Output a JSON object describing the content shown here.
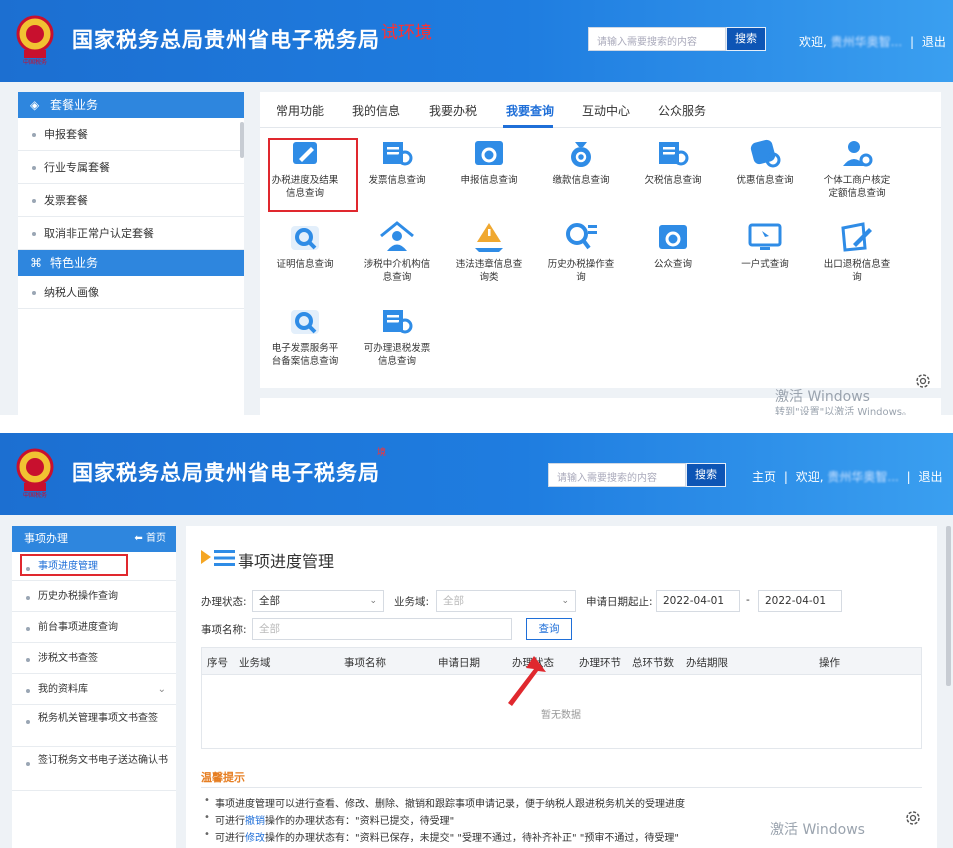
{
  "shot1": {
    "header": {
      "title": "国家税务总局贵州省电子税务局",
      "env_tag": "试环境",
      "search_placeholder": "请输入需要搜索的内容",
      "search_button": "搜索",
      "welcome": "欢迎,",
      "username": "贵州华奥智...",
      "sep": "|",
      "logout": "退出"
    },
    "sidebar": {
      "section1": "套餐业务",
      "items1": [
        "申报套餐",
        "行业专属套餐",
        "发票套餐",
        "取消非正常户认定套餐"
      ],
      "section2": "特色业务",
      "items2": [
        "纳税人画像"
      ]
    },
    "tabs": [
      "常用功能",
      "我的信息",
      "我要办税",
      "我要查询",
      "互动中心",
      "公众服务"
    ],
    "active_tab": "我要查询",
    "tiles": [
      {
        "l1": "办税进度及结果",
        "l2": "信息查询",
        "icon": "pencil-doc-icon",
        "color": "#2f8ce6"
      },
      {
        "l1": "发票信息查询",
        "l2": "",
        "icon": "invoice-search-icon",
        "color": "#2f8ce6"
      },
      {
        "l1": "申报信息查询",
        "l2": "",
        "icon": "window-search-icon",
        "color": "#2f8ce6"
      },
      {
        "l1": "缴款信息查询",
        "l2": "",
        "icon": "money-bag-icon",
        "color": "#2f8ce6"
      },
      {
        "l1": "欠税信息查询",
        "l2": "",
        "icon": "invoice-search-icon",
        "color": "#2f8ce6"
      },
      {
        "l1": "优惠信息查询",
        "l2": "",
        "icon": "discount-tag-icon",
        "color": "#2f8ce6"
      },
      {
        "l1": "个体工商户核定",
        "l2": "定额信息查询",
        "icon": "person-search-icon",
        "color": "#2f8ce6"
      },
      {
        "l1": "证明信息查询",
        "l2": "",
        "icon": "magnifier-icon",
        "color": "#2f8ce6"
      },
      {
        "l1": "涉税中介机构信",
        "l2": "息查询",
        "icon": "agent-house-icon",
        "color": "#2f8ce6"
      },
      {
        "l1": "违法违章信息查",
        "l2": "询类",
        "icon": "warning-hand-icon",
        "color": "#f0a830"
      },
      {
        "l1": "历史办税操作查",
        "l2": "询",
        "icon": "list-search-icon",
        "color": "#2f8ce6"
      },
      {
        "l1": "公众查询",
        "l2": "",
        "icon": "window-search-icon",
        "color": "#2f8ce6"
      },
      {
        "l1": "一户式查询",
        "l2": "",
        "icon": "monitor-cursor-icon",
        "color": "#2f8ce6"
      },
      {
        "l1": "出口退税信息查",
        "l2": "询",
        "icon": "pen-edit-icon",
        "color": "#2f8ce6"
      },
      {
        "l1": "电子发票服务平",
        "l2": "台备案信息查询",
        "icon": "magnifier-icon",
        "color": "#2f8ce6"
      },
      {
        "l1": "可办理退税发票",
        "l2": "信息查询",
        "icon": "invoice-search-icon",
        "color": "#2f8ce6"
      }
    ],
    "watermark": {
      "l1": "激活 Windows",
      "l2": "转到\"设置\"以激活 Windows。"
    }
  },
  "shot2": {
    "header": {
      "title": "国家税务总局贵州省电子税务局",
      "env_tag": "境",
      "search_placeholder": "请输入需要搜索的内容",
      "search_button": "搜索",
      "home": "主页",
      "welcome": "欢迎,",
      "username": "贵州华奥智...",
      "sep": "|",
      "logout": "退出"
    },
    "sidebar": {
      "title": "事项办理",
      "home_link": "首页",
      "items": [
        "事项进度管理",
        "历史办税操作查询",
        "前台事项进度查询",
        "涉税文书查签",
        "我的资料库",
        "税务机关管理事项文书查签",
        "签订税务文书电子送达确认书"
      ]
    },
    "page_title": "事项进度管理",
    "filters": {
      "status_label": "办理状态:",
      "status_value": "全部",
      "domain_label": "业务域:",
      "domain_value": "全部",
      "date_label": "申请日期起止:",
      "date_from": "2022-04-01",
      "date_sep": "-",
      "date_to": "2022-04-01",
      "name_label": "事项名称:",
      "name_value": "全部",
      "query_button": "查询"
    },
    "table": {
      "columns": [
        "序号",
        "业务域",
        "事项名称",
        "申请日期",
        "办理状态",
        "办理环节",
        "总环节数",
        "办结期限",
        "操作"
      ],
      "empty": "暂无数据"
    },
    "tips": {
      "title": "温馨提示",
      "t1": "事项进度管理可以进行查看、修改、删除、撤销和跟踪事项申请记录，便于纳税人跟进税务机关的受理进度",
      "t2a": "可进行",
      "t2b": "撤销",
      "t2c": "操作的办理状态有：\"资料已提交，待受理\"",
      "t3a": "可进行",
      "t3b": "修改",
      "t3c": "操作的办理状态有：\"资料已保存，未提交\"  \"受理不通过，待补齐补正\"  \"预审不通过，待受理\""
    },
    "watermark": {
      "l1": "激活 Windows"
    }
  }
}
